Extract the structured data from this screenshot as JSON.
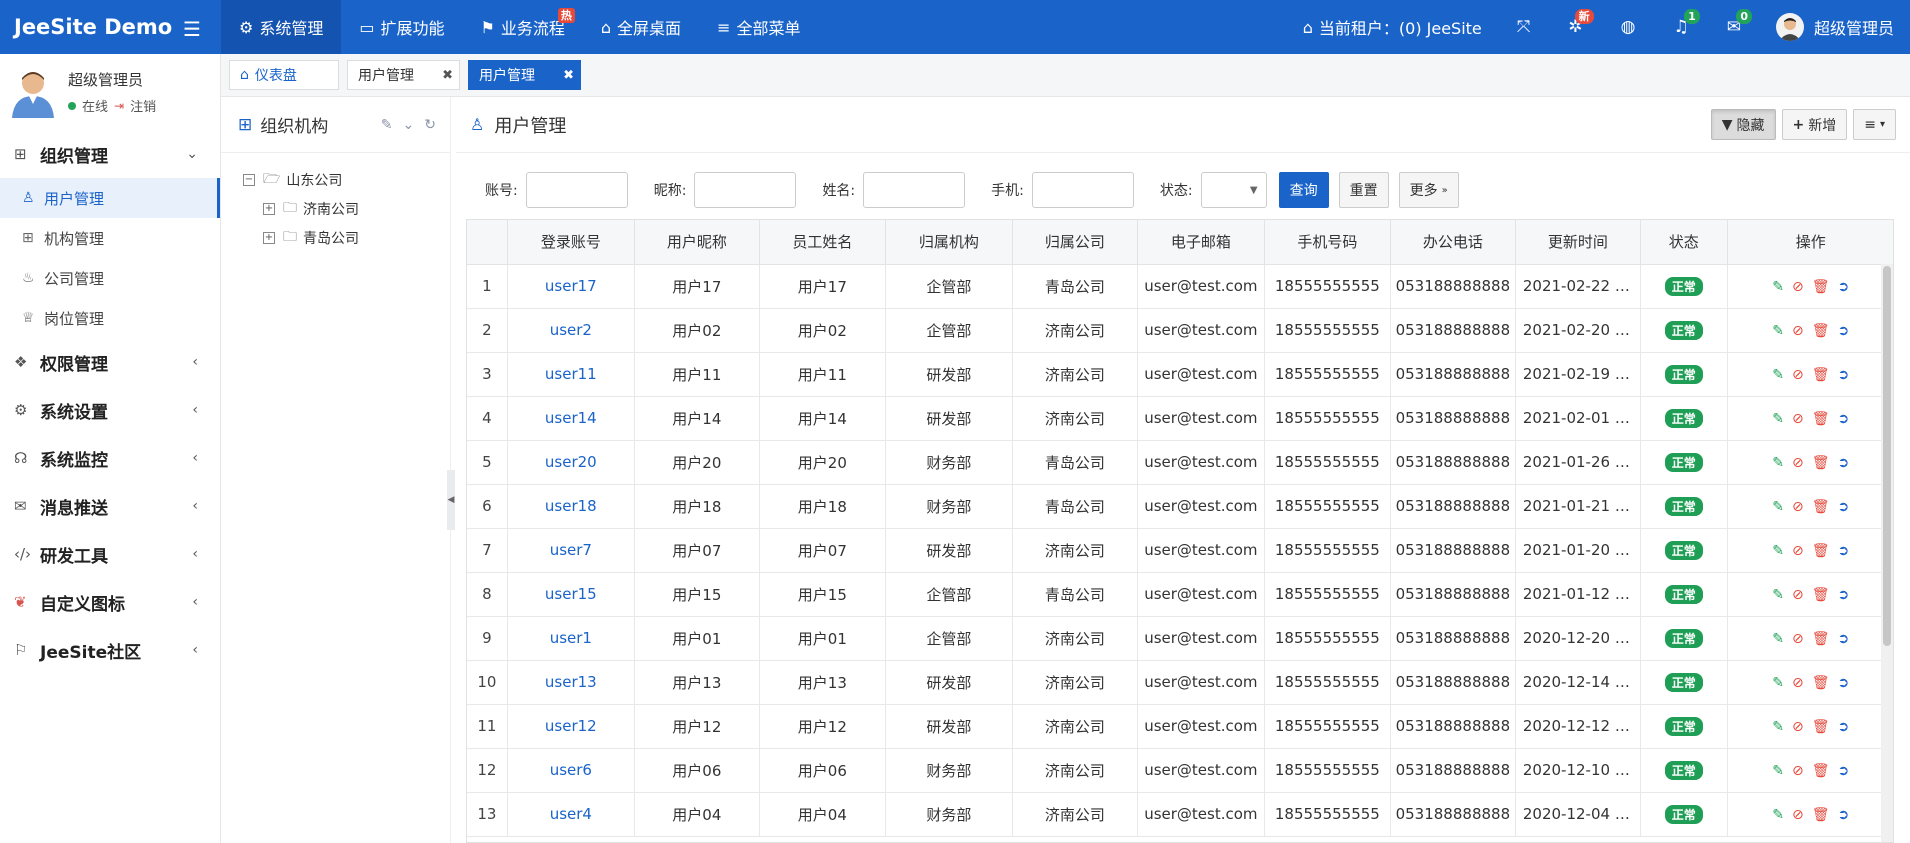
{
  "header": {
    "logo": "JeeSite Demo",
    "nav": [
      {
        "label": "系统管理",
        "icon": "gear-icon",
        "active": true
      },
      {
        "label": "扩展功能",
        "icon": "monitor-icon"
      },
      {
        "label": "业务流程",
        "icon": "flag-icon",
        "badge": "热"
      },
      {
        "label": "全屏桌面",
        "icon": "home-icon"
      },
      {
        "label": "全部菜单",
        "icon": "list-icon"
      }
    ],
    "tenant": "当前租户：(0) JeeSite",
    "badge_new": "新",
    "badge_bell": "1",
    "badge_mail": "0",
    "username": "超级管理员"
  },
  "sidebar": {
    "user_name": "超级管理员",
    "online": "在线",
    "logout": "注销",
    "menu": {
      "group_org": "组织管理",
      "sub_user": "用户管理",
      "sub_office": "机构管理",
      "sub_company": "公司管理",
      "sub_post": "岗位管理",
      "group_auth": "权限管理",
      "group_sys": "系统设置",
      "group_monitor": "系统监控",
      "group_msg": "消息推送",
      "group_dev": "研发工具",
      "group_icon": "自定义图标",
      "group_community": "JeeSite社区"
    }
  },
  "tabs": {
    "home": "仪表盘",
    "t2": "用户管理",
    "t3": "用户管理"
  },
  "tree": {
    "title": "组织机构",
    "root": "山东公司",
    "child1": "济南公司",
    "child2": "青岛公司"
  },
  "main": {
    "title": "用户管理",
    "btn_hide": "隐藏",
    "btn_add": "新增",
    "search": {
      "account": "账号:",
      "nickname": "昵称:",
      "name": "姓名:",
      "phone": "手机:",
      "status": "状态:",
      "btn_query": "查询",
      "btn_reset": "重置",
      "btn_more": "更多"
    },
    "columns": [
      "",
      "登录账号",
      "用户昵称",
      "员工姓名",
      "归属机构",
      "归属公司",
      "电子邮箱",
      "手机号码",
      "办公电话",
      "更新时间",
      "状态",
      "操作"
    ],
    "rows": [
      {
        "n": "1",
        "acc": "user17",
        "nick": "用户17",
        "name": "用户17",
        "org": "企管部",
        "comp": "青岛公司",
        "email": "user@test.com",
        "mobile": "18555555555",
        "phone": "053188888888",
        "upd": "2021-02-22 1...",
        "status": "正常"
      },
      {
        "n": "2",
        "acc": "user2",
        "nick": "用户02",
        "name": "用户02",
        "org": "企管部",
        "comp": "济南公司",
        "email": "user@test.com",
        "mobile": "18555555555",
        "phone": "053188888888",
        "upd": "2021-02-20 1...",
        "status": "正常"
      },
      {
        "n": "3",
        "acc": "user11",
        "nick": "用户11",
        "name": "用户11",
        "org": "研发部",
        "comp": "济南公司",
        "email": "user@test.com",
        "mobile": "18555555555",
        "phone": "053188888888",
        "upd": "2021-02-19 2...",
        "status": "正常"
      },
      {
        "n": "4",
        "acc": "user14",
        "nick": "用户14",
        "name": "用户14",
        "org": "研发部",
        "comp": "济南公司",
        "email": "user@test.com",
        "mobile": "18555555555",
        "phone": "053188888888",
        "upd": "2021-02-01 1...",
        "status": "正常"
      },
      {
        "n": "5",
        "acc": "user20",
        "nick": "用户20",
        "name": "用户20",
        "org": "财务部",
        "comp": "青岛公司",
        "email": "user@test.com",
        "mobile": "18555555555",
        "phone": "053188888888",
        "upd": "2021-01-26 1...",
        "status": "正常"
      },
      {
        "n": "6",
        "acc": "user18",
        "nick": "用户18",
        "name": "用户18",
        "org": "财务部",
        "comp": "青岛公司",
        "email": "user@test.com",
        "mobile": "18555555555",
        "phone": "053188888888",
        "upd": "2021-01-21 1...",
        "status": "正常"
      },
      {
        "n": "7",
        "acc": "user7",
        "nick": "用户07",
        "name": "用户07",
        "org": "研发部",
        "comp": "济南公司",
        "email": "user@test.com",
        "mobile": "18555555555",
        "phone": "053188888888",
        "upd": "2021-01-20 1...",
        "status": "正常"
      },
      {
        "n": "8",
        "acc": "user15",
        "nick": "用户15",
        "name": "用户15",
        "org": "企管部",
        "comp": "青岛公司",
        "email": "user@test.com",
        "mobile": "18555555555",
        "phone": "053188888888",
        "upd": "2021-01-12 1...",
        "status": "正常"
      },
      {
        "n": "9",
        "acc": "user1",
        "nick": "用户01",
        "name": "用户01",
        "org": "企管部",
        "comp": "济南公司",
        "email": "user@test.com",
        "mobile": "18555555555",
        "phone": "053188888888",
        "upd": "2020-12-20 2...",
        "status": "正常"
      },
      {
        "n": "10",
        "acc": "user13",
        "nick": "用户13",
        "name": "用户13",
        "org": "研发部",
        "comp": "济南公司",
        "email": "user@test.com",
        "mobile": "18555555555",
        "phone": "053188888888",
        "upd": "2020-12-14 1...",
        "status": "正常"
      },
      {
        "n": "11",
        "acc": "user12",
        "nick": "用户12",
        "name": "用户12",
        "org": "研发部",
        "comp": "济南公司",
        "email": "user@test.com",
        "mobile": "18555555555",
        "phone": "053188888888",
        "upd": "2020-12-12 1...",
        "status": "正常"
      },
      {
        "n": "12",
        "acc": "user6",
        "nick": "用户06",
        "name": "用户06",
        "org": "财务部",
        "comp": "济南公司",
        "email": "user@test.com",
        "mobile": "18555555555",
        "phone": "053188888888",
        "upd": "2020-12-10 1...",
        "status": "正常"
      },
      {
        "n": "13",
        "acc": "user4",
        "nick": "用户04",
        "name": "用户04",
        "org": "财务部",
        "comp": "济南公司",
        "email": "user@test.com",
        "mobile": "18555555555",
        "phone": "053188888888",
        "upd": "2020-12-04 1...",
        "status": "正常"
      }
    ]
  },
  "colors": {
    "primary": "#1a63c9",
    "status_green": "#1f9e55",
    "danger": "#e64a3b"
  }
}
